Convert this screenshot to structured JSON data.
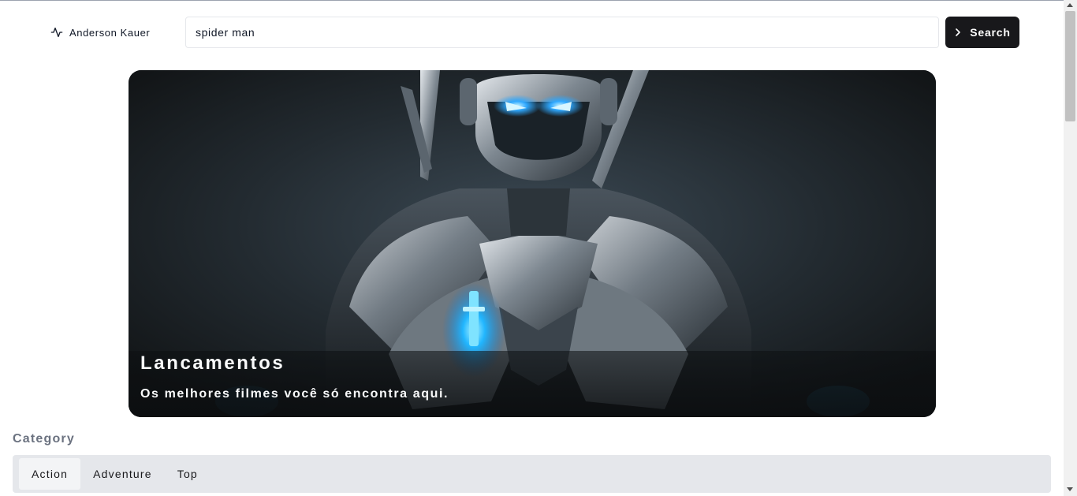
{
  "header": {
    "brand_name": "Anderson Kauer",
    "brand_icon": "activity-pulse-icon",
    "search": {
      "value": "spider man",
      "placeholder": ""
    },
    "search_button_label": "Search",
    "search_button_icon": "chevron-right-icon"
  },
  "hero": {
    "title": "Lancamentos",
    "subtitle": "Os melhores filmes você só encontra aqui.",
    "image": "armored-robot-hero-image"
  },
  "category": {
    "heading": "Category",
    "tabs": [
      {
        "label": "Action",
        "active": true
      },
      {
        "label": "Adventure",
        "active": false
      },
      {
        "label": "Top",
        "active": false
      }
    ]
  },
  "colors": {
    "button_bg": "#18181b",
    "tabs_bg": "#e5e7eb",
    "accent_glow": "#2ea8ff"
  }
}
